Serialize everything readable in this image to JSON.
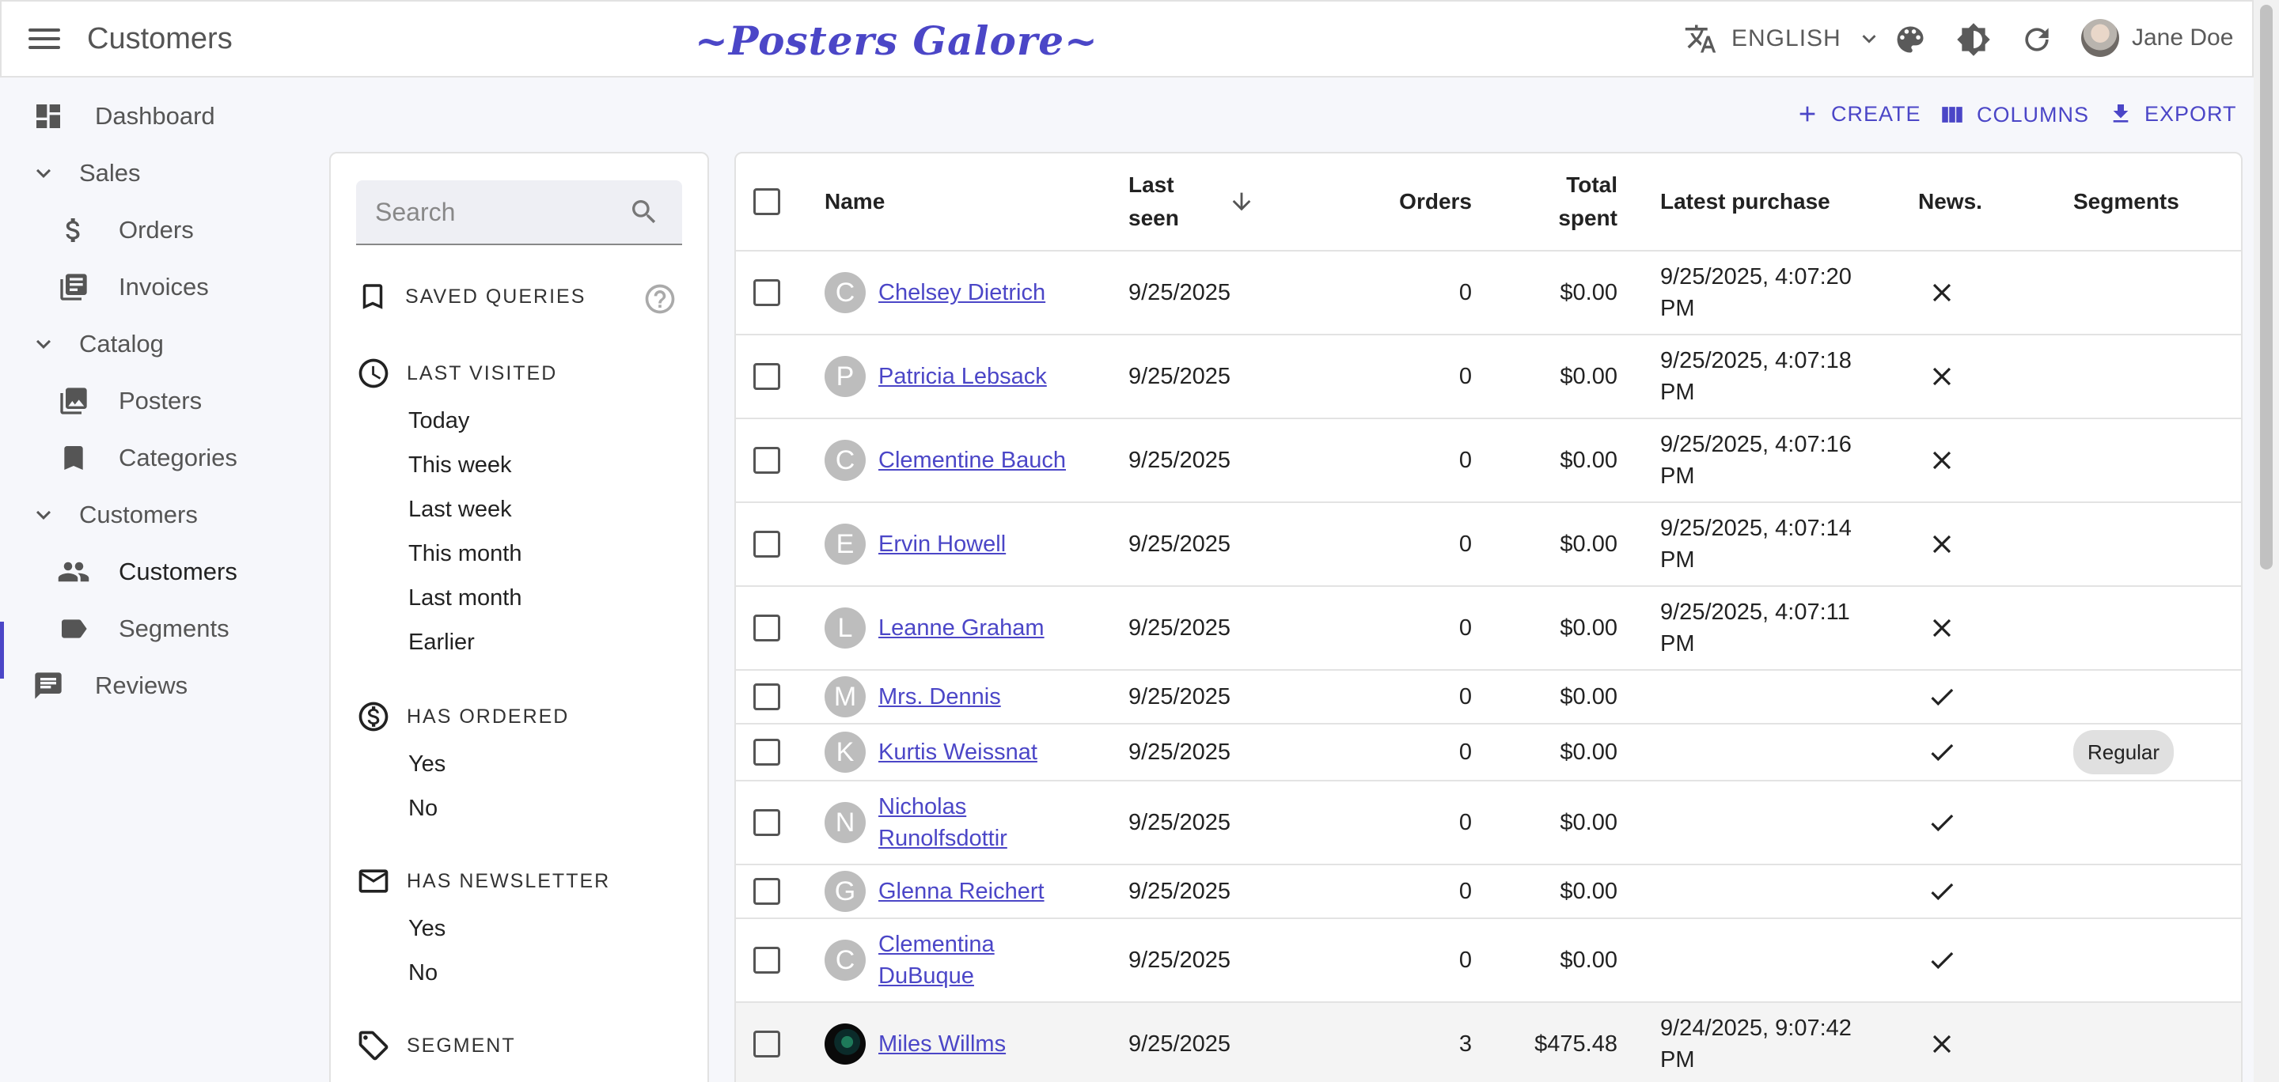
{
  "appbar": {
    "title": "Customers",
    "brand": "~Posters Galore~",
    "language": "ENGLISH",
    "user_name": "Jane Doe"
  },
  "sidebar": {
    "items": [
      {
        "label": "Dashboard",
        "icon": "dashboard-icon"
      },
      {
        "label": "Sales",
        "icon": "chevron-down-icon"
      },
      {
        "label": "Orders",
        "icon": "dollar-icon"
      },
      {
        "label": "Invoices",
        "icon": "library-books-icon"
      },
      {
        "label": "Catalog",
        "icon": "chevron-down-icon"
      },
      {
        "label": "Posters",
        "icon": "collections-icon"
      },
      {
        "label": "Categories",
        "icon": "bookmark-icon"
      },
      {
        "label": "Customers",
        "icon": "chevron-down-icon"
      },
      {
        "label": "Customers",
        "icon": "people-icon",
        "active": true
      },
      {
        "label": "Segments",
        "icon": "label-icon"
      },
      {
        "label": "Reviews",
        "icon": "comment-icon"
      }
    ]
  },
  "toolbar": {
    "create": "CREATE",
    "columns": "COLUMNS",
    "export": "EXPORT"
  },
  "filters": {
    "search_placeholder": "Search",
    "saved_queries": "SAVED QUERIES",
    "last_visited": {
      "label": "LAST VISITED",
      "options": [
        "Today",
        "This week",
        "Last week",
        "This month",
        "Last month",
        "Earlier"
      ]
    },
    "has_ordered": {
      "label": "HAS ORDERED",
      "options": [
        "Yes",
        "No"
      ]
    },
    "has_newsletter": {
      "label": "HAS NEWSLETTER",
      "options": [
        "Yes",
        "No"
      ]
    },
    "segment": {
      "label": "SEGMENT"
    }
  },
  "table": {
    "headers": {
      "name": "Name",
      "last_seen": "Last seen",
      "orders": "Orders",
      "total_spent": "Total spent",
      "latest_purchase": "Latest purchase",
      "news": "News.",
      "segments": "Segments"
    },
    "rows": [
      {
        "initial": "C",
        "name": "Chelsey Dietrich",
        "last_seen": "9/25/2025",
        "orders": "0",
        "total": "$0.00",
        "latest": "9/25/2025, 4:07:20 PM",
        "news": false,
        "segment": ""
      },
      {
        "initial": "P",
        "name": "Patricia Lebsack",
        "last_seen": "9/25/2025",
        "orders": "0",
        "total": "$0.00",
        "latest": "9/25/2025, 4:07:18 PM",
        "news": false,
        "segment": ""
      },
      {
        "initial": "C",
        "name": "Clementine Bauch",
        "last_seen": "9/25/2025",
        "orders": "0",
        "total": "$0.00",
        "latest": "9/25/2025, 4:07:16 PM",
        "news": false,
        "segment": ""
      },
      {
        "initial": "E",
        "name": "Ervin Howell",
        "last_seen": "9/25/2025",
        "orders": "0",
        "total": "$0.00",
        "latest": "9/25/2025, 4:07:14 PM",
        "news": false,
        "segment": ""
      },
      {
        "initial": "L",
        "name": "Leanne Graham",
        "last_seen": "9/25/2025",
        "orders": "0",
        "total": "$0.00",
        "latest": "9/25/2025, 4:07:11 PM",
        "news": false,
        "segment": ""
      },
      {
        "initial": "M",
        "name": "Mrs. Dennis",
        "last_seen": "9/25/2025",
        "orders": "0",
        "total": "$0.00",
        "latest": "",
        "news": true,
        "segment": ""
      },
      {
        "initial": "K",
        "name": "Kurtis Weissnat",
        "last_seen": "9/25/2025",
        "orders": "0",
        "total": "$0.00",
        "latest": "",
        "news": true,
        "segment": "Regular"
      },
      {
        "initial": "N",
        "name": "Nicholas Runolfsdottir",
        "last_seen": "9/25/2025",
        "orders": "0",
        "total": "$0.00",
        "latest": "",
        "news": true,
        "segment": ""
      },
      {
        "initial": "G",
        "name": "Glenna Reichert",
        "last_seen": "9/25/2025",
        "orders": "0",
        "total": "$0.00",
        "latest": "",
        "news": true,
        "segment": ""
      },
      {
        "initial": "C",
        "name": "Clementina DuBuque",
        "last_seen": "9/25/2025",
        "orders": "0",
        "total": "$0.00",
        "latest": "",
        "news": true,
        "segment": ""
      },
      {
        "initial": "",
        "name": "Miles Willms",
        "last_seen": "9/25/2025",
        "orders": "3",
        "total": "$475.48",
        "latest": "9/24/2025, 9:07:42 PM",
        "news": false,
        "segment": "",
        "photo": true
      }
    ]
  },
  "colors": {
    "accent": "#4b46c7",
    "text": "#222222",
    "muted": "#555555"
  }
}
